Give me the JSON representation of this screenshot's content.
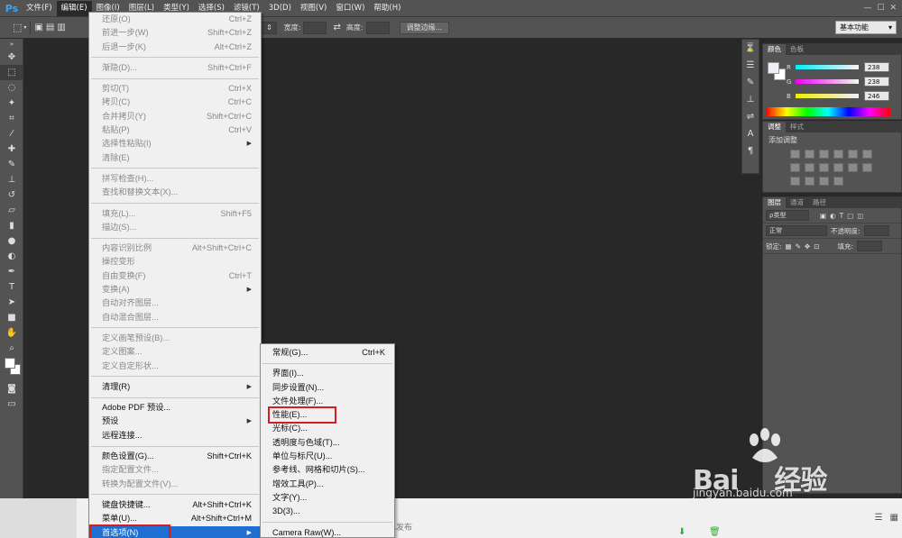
{
  "app": {
    "logo": "Ps"
  },
  "menubar": {
    "items": [
      "文件(F)",
      "编辑(E)",
      "图像(I)",
      "图层(L)",
      "类型(Y)",
      "选择(S)",
      "滤镜(T)",
      "3D(D)",
      "视图(V)",
      "窗口(W)",
      "帮助(H)"
    ],
    "active_index": 1
  },
  "options_bar": {
    "style_label": "",
    "width_label": "宽度:",
    "height_label": "高度:",
    "refine_button": "调整边缘...",
    "workspace": "基本功能"
  },
  "edit_menu": {
    "groups": [
      [
        {
          "label": "还原(O)",
          "shortcut": "Ctrl+Z",
          "disabled": true
        },
        {
          "label": "前进一步(W)",
          "shortcut": "Shift+Ctrl+Z",
          "disabled": true
        },
        {
          "label": "后退一步(K)",
          "shortcut": "Alt+Ctrl+Z",
          "disabled": true
        }
      ],
      [
        {
          "label": "渐隐(D)...",
          "shortcut": "Shift+Ctrl+F",
          "disabled": true
        }
      ],
      [
        {
          "label": "剪切(T)",
          "shortcut": "Ctrl+X",
          "disabled": true
        },
        {
          "label": "拷贝(C)",
          "shortcut": "Ctrl+C",
          "disabled": true
        },
        {
          "label": "合并拷贝(Y)",
          "shortcut": "Shift+Ctrl+C",
          "disabled": true
        },
        {
          "label": "粘贴(P)",
          "shortcut": "Ctrl+V",
          "disabled": true
        },
        {
          "label": "选择性粘贴(I)",
          "shortcut": "",
          "disabled": true,
          "submenu": true
        },
        {
          "label": "清除(E)",
          "shortcut": "",
          "disabled": true
        }
      ],
      [
        {
          "label": "拼写检查(H)...",
          "shortcut": "",
          "disabled": true
        },
        {
          "label": "查找和替换文本(X)...",
          "shortcut": "",
          "disabled": true
        }
      ],
      [
        {
          "label": "填充(L)...",
          "shortcut": "Shift+F5",
          "disabled": true
        },
        {
          "label": "描边(S)...",
          "shortcut": "",
          "disabled": true
        }
      ],
      [
        {
          "label": "内容识别比例",
          "shortcut": "Alt+Shift+Ctrl+C",
          "disabled": true
        },
        {
          "label": "操控变形",
          "shortcut": "",
          "disabled": true
        },
        {
          "label": "自由变换(F)",
          "shortcut": "Ctrl+T",
          "disabled": true
        },
        {
          "label": "变换(A)",
          "shortcut": "",
          "disabled": true,
          "submenu": true
        },
        {
          "label": "自动对齐图层...",
          "shortcut": "",
          "disabled": true
        },
        {
          "label": "自动混合图层...",
          "shortcut": "",
          "disabled": true
        }
      ],
      [
        {
          "label": "定义画笔预设(B)...",
          "shortcut": "",
          "disabled": true
        },
        {
          "label": "定义图案...",
          "shortcut": "",
          "disabled": true
        },
        {
          "label": "定义自定形状...",
          "shortcut": "",
          "disabled": true
        }
      ],
      [
        {
          "label": "清理(R)",
          "shortcut": "",
          "disabled": false,
          "submenu": true
        }
      ],
      [
        {
          "label": "Adobe PDF 预设...",
          "shortcut": "",
          "disabled": false
        },
        {
          "label": "预设",
          "shortcut": "",
          "disabled": false,
          "submenu": true
        },
        {
          "label": "远程连接...",
          "shortcut": "",
          "disabled": false
        }
      ],
      [
        {
          "label": "颜色设置(G)...",
          "shortcut": "Shift+Ctrl+K",
          "disabled": false
        },
        {
          "label": "指定配置文件...",
          "shortcut": "",
          "disabled": true
        },
        {
          "label": "转换为配置文件(V)...",
          "shortcut": "",
          "disabled": true
        }
      ],
      [
        {
          "label": "键盘快捷键...",
          "shortcut": "Alt+Shift+Ctrl+K",
          "disabled": false
        },
        {
          "label": "菜单(U)...",
          "shortcut": "Alt+Shift+Ctrl+M",
          "disabled": false
        },
        {
          "label": "首选项(N)",
          "shortcut": "",
          "disabled": false,
          "submenu": true,
          "highlighted": true
        }
      ]
    ]
  },
  "preferences_submenu": {
    "groups": [
      [
        {
          "label": "常规(G)...",
          "shortcut": "Ctrl+K"
        }
      ],
      [
        {
          "label": "界面(I)...",
          "shortcut": ""
        },
        {
          "label": "同步设置(N)...",
          "shortcut": ""
        },
        {
          "label": "文件处理(F)...",
          "shortcut": ""
        },
        {
          "label": "性能(E)...",
          "shortcut": "",
          "boxed": true
        },
        {
          "label": "光标(C)...",
          "shortcut": ""
        },
        {
          "label": "透明度与色域(T)...",
          "shortcut": ""
        },
        {
          "label": "单位与标尺(U)...",
          "shortcut": ""
        },
        {
          "label": "参考线、网格和切片(S)...",
          "shortcut": ""
        },
        {
          "label": "增效工具(P)...",
          "shortcut": ""
        },
        {
          "label": "文字(Y)...",
          "shortcut": ""
        },
        {
          "label": "3D(3)...",
          "shortcut": ""
        }
      ],
      [
        {
          "label": "Camera Raw(W)...",
          "shortcut": ""
        }
      ]
    ]
  },
  "color_panel": {
    "tabs": [
      "颜色",
      "色板"
    ],
    "channels": [
      {
        "label": "R",
        "value": "238",
        "color": "#ff5555"
      },
      {
        "label": "G",
        "value": "238",
        "color": "#ff55ff"
      },
      {
        "label": "B",
        "value": "246",
        "color": "#ffff55"
      }
    ]
  },
  "adjustments_panel": {
    "tabs": [
      "调整",
      "样式"
    ],
    "title": "添加调整"
  },
  "layers_panel": {
    "tabs": [
      "图层",
      "通道",
      "路径"
    ],
    "filter_kind": "ρ类型",
    "blend_mode": "正常",
    "opacity_label": "不透明度:",
    "lock_label": "锁定:",
    "fill_label": "填充:"
  },
  "bottom_bar": {
    "partial_text": "已发布"
  },
  "watermark": {
    "brand": "Bai",
    "brand_suffix": "经验",
    "url": "jingyan.baidu.com"
  }
}
